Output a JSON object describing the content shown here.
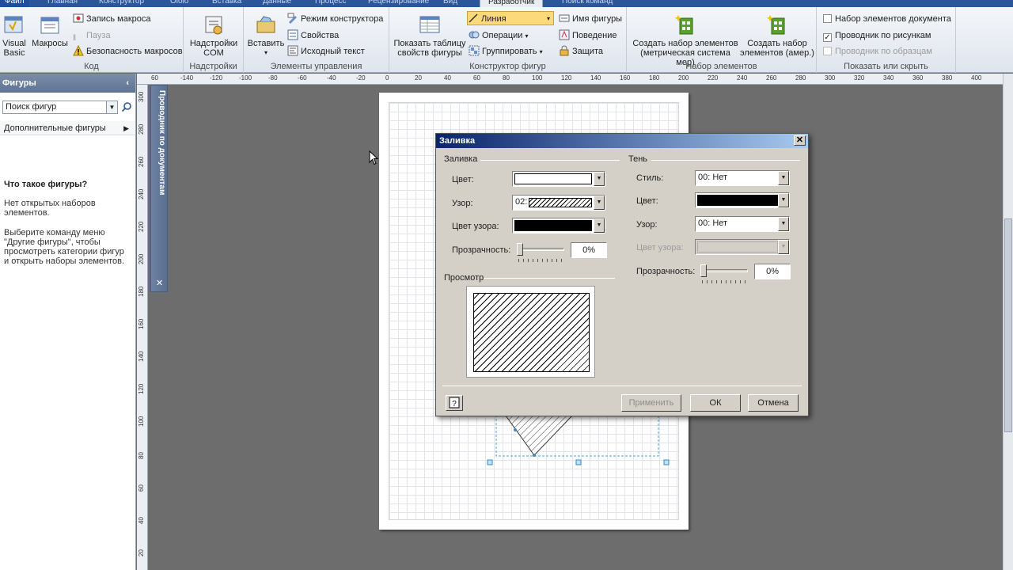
{
  "tabs": [
    {
      "label": "Файл",
      "kind": "file"
    },
    {
      "label": "Главная"
    },
    {
      "label": "Конструктор"
    },
    {
      "label": "Oiolo"
    },
    {
      "label": "Вставка"
    },
    {
      "label": "Данные"
    },
    {
      "label": "Процесс"
    },
    {
      "label": "Рецензирование"
    },
    {
      "label": "Вид"
    },
    {
      "label": "Разработчик",
      "active": true
    },
    {
      "label": "Поиск команд"
    }
  ],
  "ribbon": {
    "code": {
      "label": "Код",
      "visual_basic": "Visual Basic",
      "macros": "Макросы",
      "record_macro": "Запись макроса",
      "pause": "Пауза",
      "macro_security": "Безопасность макросов"
    },
    "addins": {
      "label": "Надстройки",
      "com_addins": "Надстройки COM"
    },
    "controls": {
      "label": "Элементы управления",
      "insert": "Вставить",
      "design_mode": "Режим конструктора",
      "properties": "Свойства",
      "view_code": "Исходный текст"
    },
    "shape_design": {
      "label": "Конструктор фигур",
      "show_shapesheet": "Показать таблицу свойств фигуры",
      "line": "Линия",
      "operations": "Операции",
      "group": "Группировать",
      "shape_name": "Имя фигуры",
      "behavior": "Поведение",
      "protection": "Защита"
    },
    "stencil": {
      "label": "Набор элементов",
      "new_metric": "Создать набор элементов (метрическая система мер)",
      "new_us": "Создать набор элементов (амер.)"
    },
    "show_hide": {
      "label": "Показать или скрыть",
      "document_stencil": "Набор элементов документа",
      "drawing_explorer": "Проводник по рисункам",
      "master_explorer": "Проводник по образцам"
    }
  },
  "shapes_pane": {
    "title": "Фигуры",
    "search_placeholder": "Поиск фигур",
    "more_shapes": "Дополнительные фигуры",
    "what_title": "Что такое фигуры?",
    "no_stencils": "Нет открытых наборов элементов.",
    "hint": "Выберите команду меню \"Другие фигуры\", чтобы просмотреть категории фигур и открыть наборы элементов."
  },
  "doc_explorer": {
    "title": "Проводник по документам"
  },
  "ruler_top": [
    "60",
    "-140",
    "-120",
    "-100",
    "-80",
    "-60",
    "-40",
    "-20",
    "0",
    "20",
    "40",
    "60",
    "80",
    "100",
    "120",
    "140",
    "160",
    "180",
    "200",
    "220",
    "240",
    "260",
    "280",
    "300",
    "320",
    "340",
    "360",
    "380",
    "400"
  ],
  "ruler_left": [
    "300",
    "280",
    "260",
    "240",
    "220",
    "200",
    "180",
    "160",
    "140",
    "120",
    "100",
    "80",
    "60",
    "40",
    "20"
  ],
  "dialog": {
    "title": "Заливка",
    "fill_section": "Заливка",
    "shadow_section": "Тень",
    "preview_section": "Просмотр",
    "fill": {
      "color_label": "Цвет:",
      "pattern_label": "Узор:",
      "pattern_value": "02:",
      "pattern_color_label": "Цвет узора:",
      "transparency_label": "Прозрачность:",
      "transparency_value": "0%",
      "color": "#ffffff",
      "pattern_color": "#000000",
      "transparency_level": 0
    },
    "shadow": {
      "style_label": "Стиль:",
      "style_value": "00: Нет",
      "color_label": "Цвет:",
      "pattern_label": "Узор:",
      "pattern_value": "00: Нет",
      "pattern_color_label": "Цвет узора:",
      "transparency_label": "Прозрачность:",
      "transparency_value": "0%",
      "color": "#000000",
      "transparency_level": 0
    },
    "buttons": {
      "apply": "Применить",
      "ok": "ОК",
      "cancel": "Отмена"
    }
  }
}
